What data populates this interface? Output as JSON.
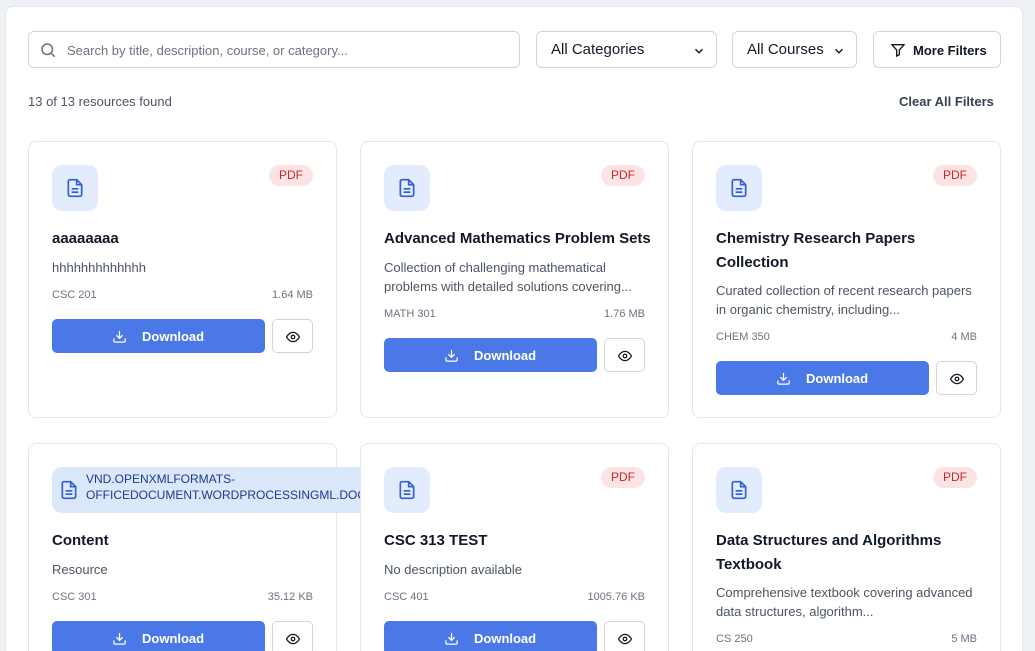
{
  "search": {
    "placeholder": "Search by title, description, course, or category..."
  },
  "filters": {
    "category": "All Categories",
    "course": "All Courses",
    "more_label": "More Filters",
    "icons": {
      "search": "search-icon",
      "chevron": "chevron-down-icon",
      "filter": "filter-icon"
    }
  },
  "results": {
    "count_text": "13 of 13 resources found",
    "clear_label": "Clear All Filters"
  },
  "cards": [
    {
      "badge": "PDF",
      "title": "aaaaaaaa",
      "description": "hhhhhhhhhhhhh",
      "course": "CSC 201",
      "size": "1.64 MB",
      "download": "Download"
    },
    {
      "badge": "PDF",
      "title": "Advanced Mathematics Problem Sets",
      "description": "Collection of challenging mathematical problems with detailed solutions covering...",
      "course": "MATH 301",
      "size": "1.76 MB",
      "download": "Download"
    },
    {
      "badge": "PDF",
      "title": "Chemistry Research Papers Collection",
      "description": "Curated collection of recent research papers in organic chemistry, including...",
      "course": "CHEM 350",
      "size": "4 MB",
      "download": "Download"
    },
    {
      "badge": "VND.OPENXMLFORMATS-OFFICEDOCUMENT.WORDPROCESSINGML.DOCUME",
      "title": "Content",
      "description": "Resource",
      "course": "CSC 301",
      "size": "35.12 KB",
      "download": "Download"
    },
    {
      "badge": "PDF",
      "title": "CSC 313 TEST",
      "description": "No description available",
      "course": "CSC 401",
      "size": "1005.76 KB",
      "download": "Download"
    },
    {
      "badge": "PDF",
      "title": "Data Structures and Algorithms Textbook",
      "description": "Comprehensive textbook covering advanced data structures, algorithm...",
      "course": "CS 250",
      "size": "5 MB",
      "download": "Download"
    }
  ],
  "colors": {
    "accent": "#4a78e6",
    "pdf_badge_bg": "#fde4e4",
    "pdf_badge_text": "#c62828",
    "icon_bg": "#e3ecfc"
  },
  "icons": {
    "file": "file-text-icon",
    "download": "download-icon",
    "view": "eye-icon"
  }
}
